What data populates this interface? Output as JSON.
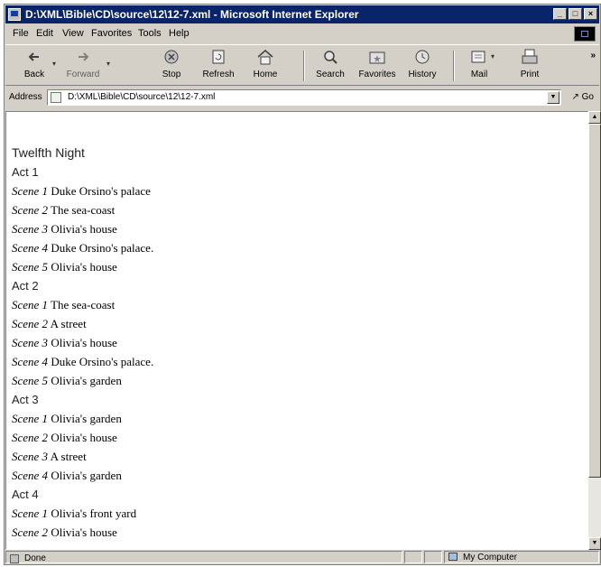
{
  "window": {
    "title": "D:\\XML\\Bible\\CD\\source\\12\\12-7.xml - Microsoft Internet Explorer"
  },
  "menu": [
    "File",
    "Edit",
    "View",
    "Favorites",
    "Tools",
    "Help"
  ],
  "toolbar": {
    "back": "Back",
    "forward": "Forward",
    "stop": "Stop",
    "refresh": "Refresh",
    "home": "Home",
    "search": "Search",
    "favorites": "Favorites",
    "history": "History",
    "mail": "Mail",
    "print": "Print"
  },
  "address": {
    "label": "Address",
    "value": "D:\\XML\\Bible\\CD\\source\\12\\12-7.xml",
    "go": "Go"
  },
  "document": {
    "title": "Twelfth Night",
    "acts": [
      {
        "label": "Act 1",
        "scenes": [
          {
            "label": "Scene 1",
            "location": "Duke Orsino's palace"
          },
          {
            "label": "Scene 2",
            "location": "The sea-coast"
          },
          {
            "label": "Scene 3",
            "location": "Olivia's house"
          },
          {
            "label": "Scene 4",
            "location": "Duke Orsino's palace."
          },
          {
            "label": "Scene 5",
            "location": "Olivia's house"
          }
        ]
      },
      {
        "label": "Act 2",
        "scenes": [
          {
            "label": "Scene 1",
            "location": "The sea-coast"
          },
          {
            "label": "Scene 2",
            "location": "A street"
          },
          {
            "label": "Scene 3",
            "location": "Olivia's house"
          },
          {
            "label": "Scene 4",
            "location": "Duke Orsino's palace."
          },
          {
            "label": "Scene 5",
            "location": "Olivia's garden"
          }
        ]
      },
      {
        "label": "Act 3",
        "scenes": [
          {
            "label": "Scene 1",
            "location": "Olivia's garden"
          },
          {
            "label": "Scene 2",
            "location": "Olivia's house"
          },
          {
            "label": "Scene 3",
            "location": "A street"
          },
          {
            "label": "Scene 4",
            "location": "Olivia's garden"
          }
        ]
      },
      {
        "label": "Act 4",
        "scenes": [
          {
            "label": "Scene 1",
            "location": "Olivia's front yard"
          },
          {
            "label": "Scene 2",
            "location": "Olivia's house"
          }
        ]
      }
    ]
  },
  "status": {
    "text": "Done",
    "zone": "My Computer"
  }
}
